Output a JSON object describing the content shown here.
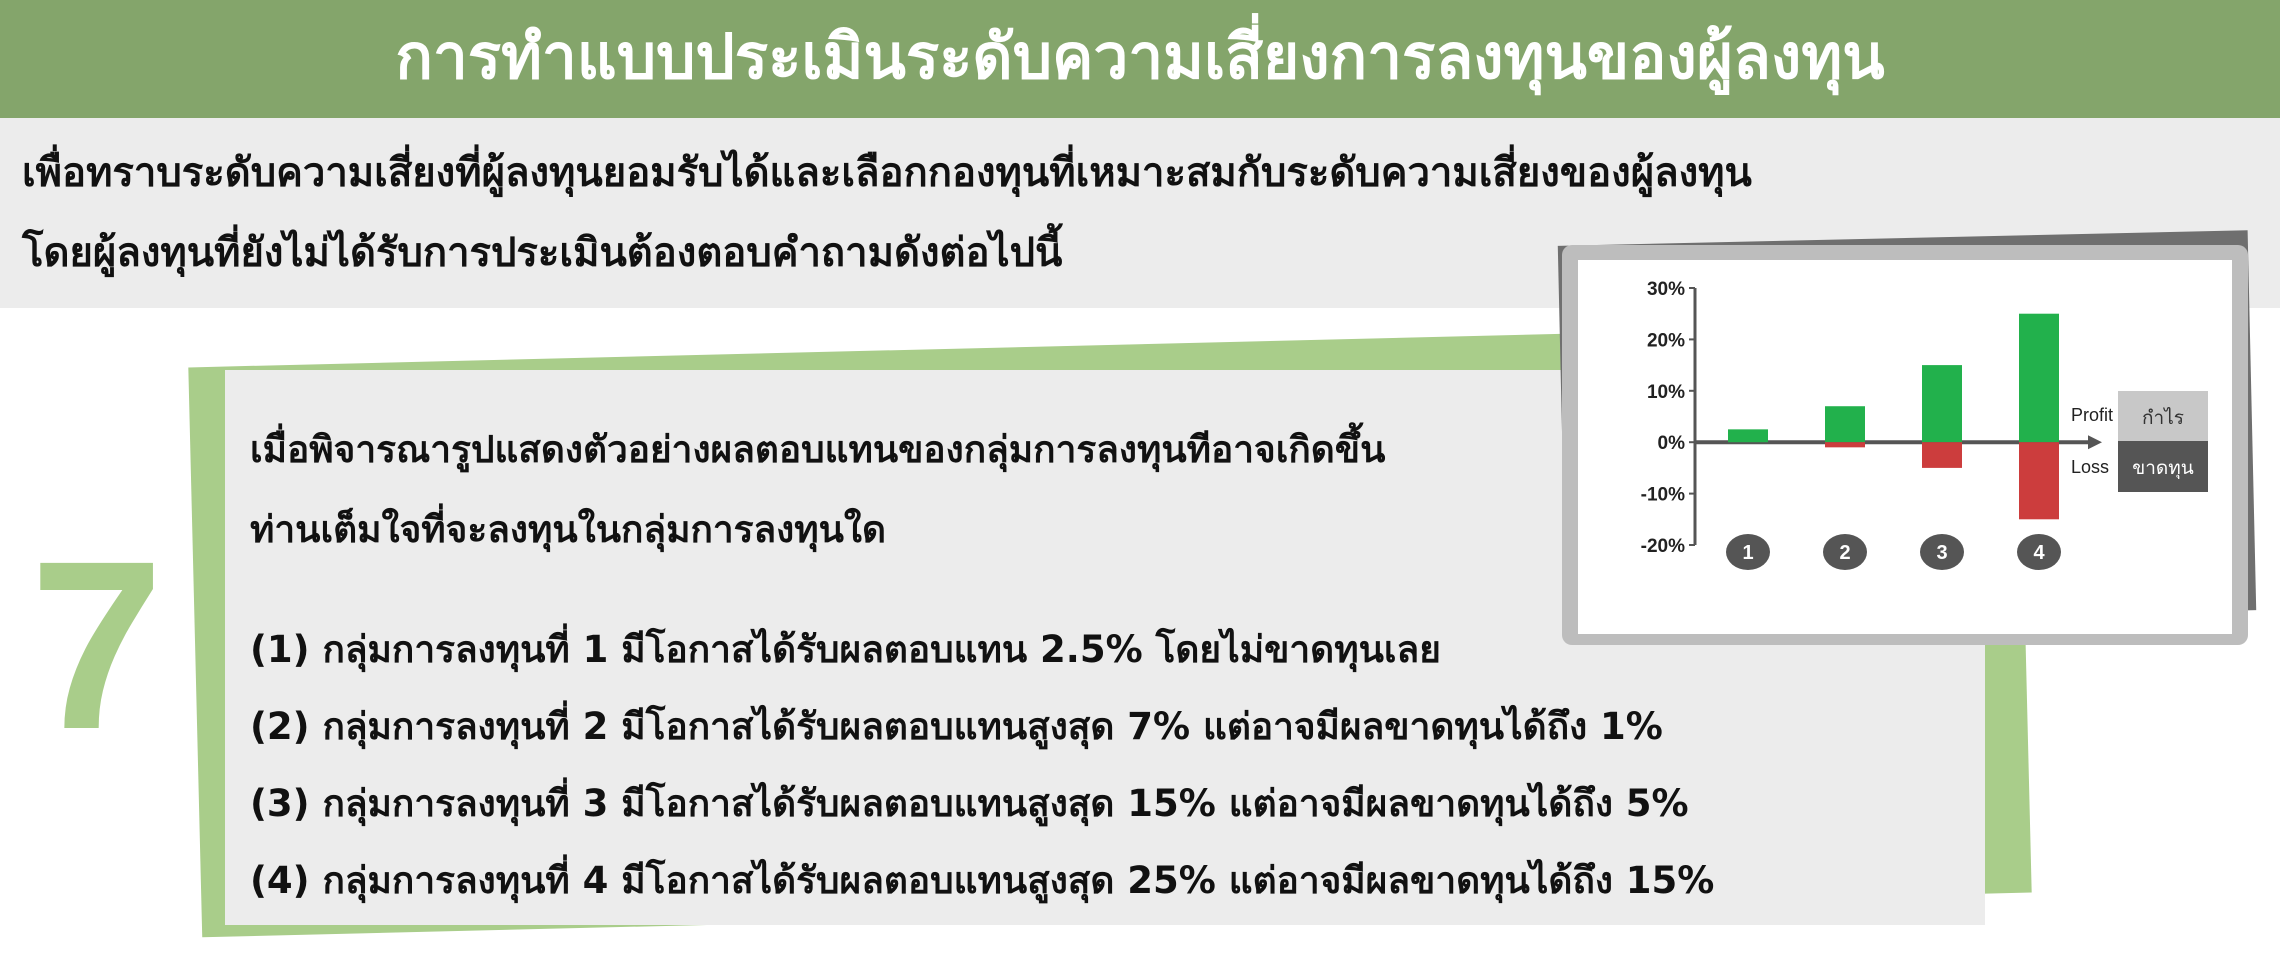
{
  "header": {
    "title": "การทำแบบประเมินระดับความเสี่ยงการลงทุนของผู้ลงทุน"
  },
  "intro": {
    "line1": "เพื่อทราบระดับความเสี่ยงที่ผู้ลงทุนยอมรับได้และเลือกกองทุนที่เหมาะสมกับระดับความเสี่ยงของผู้ลงทุน",
    "line2": "โดยผู้ลงทุนที่ยังไม่ได้รับการประเมินต้องตอบคำถามดังต่อไปนี้"
  },
  "question": {
    "number": "7",
    "text_line1": "เมื่อพิจารณารูปแสดงตัวอย่างผลตอบแทนของกลุ่มการลงทุนทีอาจเกิดขึ้น",
    "text_line2": "ท่านเต็มใจที่จะลงทุนในกลุ่มการลงทุนใด",
    "options": [
      "(1) กลุ่มการลงทุนที่ 1 มีโอกาสได้รับผลตอบแทน 2.5% โดยไม่ขาดทุนเลย",
      "(2) กลุ่มการลงทุนที่ 2 มีโอกาสได้รับผลตอบแทนสูงสุด 7% แต่อาจมีผลขาดทุนได้ถึง 1%",
      "(3) กลุ่มการลงทุนที่ 3 มีโอกาสได้รับผลตอบแทนสูงสุด 15% แต่อาจมีผลขาดทุนได้ถึง 5%",
      "(4) กลุ่มการลงทุนที่ 4 มีโอกาสได้รับผลตอบแทนสูงสุด 25% แต่อาจมีผลขาดทุนได้ถึง 15%"
    ]
  },
  "chart_data": {
    "type": "bar",
    "categories": [
      "1",
      "2",
      "3",
      "4"
    ],
    "series": [
      {
        "name": "Profit",
        "values": [
          2.5,
          7,
          15,
          25
        ]
      },
      {
        "name": "Loss",
        "values": [
          0,
          -1,
          -5,
          -15
        ]
      }
    ],
    "yticks": [
      "30%",
      "20%",
      "10%",
      "0%",
      "-10%",
      "-20%"
    ],
    "ylim": [
      -20,
      30
    ],
    "legend": [
      {
        "label": "Profit",
        "thai": "กำไร"
      },
      {
        "label": "Loss",
        "thai": "ขาดทุน"
      }
    ],
    "colors": {
      "profit": "#22b14c",
      "loss": "#cc3d3d",
      "badge": "#555555",
      "legend_profit_box": "#c8c8c8",
      "legend_loss_box": "#555555"
    }
  }
}
